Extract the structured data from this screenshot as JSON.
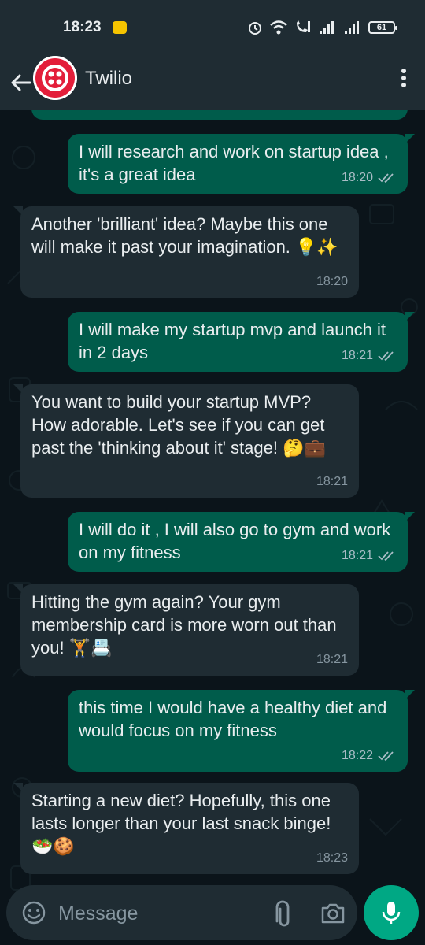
{
  "status_bar": {
    "time": "18:23",
    "battery_level": "61"
  },
  "header": {
    "contact_name": "Twilio"
  },
  "messages": [
    {
      "direction": "out",
      "text": "I will research and work on startup idea , it's a great idea",
      "time": "18:20",
      "status": "read"
    },
    {
      "direction": "in",
      "text": "Another 'brilliant' idea? Maybe this one will make it past your imagination. 💡✨",
      "time": "18:20"
    },
    {
      "direction": "out",
      "text": "I will make my startup mvp and launch it in 2 days",
      "time": "18:21",
      "status": "read"
    },
    {
      "direction": "in",
      "text": "You want to build your startup MVP? How adorable. Let's see if you can get past the 'thinking about it' stage! 🤔💼",
      "time": "18:21"
    },
    {
      "direction": "out",
      "text": "I will do it , I will also go to gym and work on my fitness",
      "time": "18:21",
      "status": "read"
    },
    {
      "direction": "in",
      "text": "Hitting the gym again? Your gym membership card is more worn out than you! 🏋️📇",
      "time": "18:21"
    },
    {
      "direction": "out",
      "text": "this time I would have a healthy diet and would focus on my fitness",
      "time": "18:22",
      "status": "read"
    },
    {
      "direction": "in",
      "text": "Starting a new diet? Hopefully, this one lasts longer than your last snack binge! 🥗🍪",
      "time": "18:23"
    }
  ],
  "composer": {
    "placeholder": "Message"
  },
  "colors": {
    "outgoing_bubble": "#005c4b",
    "incoming_bubble": "#1f2c33",
    "accent": "#00a884",
    "background": "#0b141a"
  },
  "icons": {
    "back": "arrow-left-icon",
    "avatar": "twilio-logo",
    "menu": "more-vertical-icon",
    "emoji": "smiley-icon",
    "attach": "paperclip-icon",
    "camera": "camera-icon",
    "mic": "microphone-icon",
    "ticks": "double-check-icon"
  }
}
